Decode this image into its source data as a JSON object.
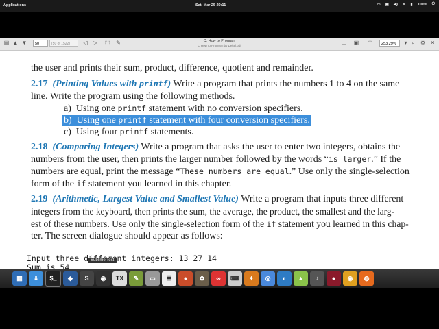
{
  "topbar": {
    "applications": "Applications",
    "clock": "Sat, Mar 25   20:11",
    "battery": "100%"
  },
  "toolbar": {
    "page_value": "50",
    "page_of": "(50 of 1522)",
    "title": "C: How to Program",
    "subtitle": "C How to Program by Deitel.pdf",
    "zoom": "253.29%"
  },
  "document": {
    "line0": "the user and prints their sum, product, difference, quotient and remainder.",
    "ex217": {
      "num": "2.17",
      "head_a": "(Printing Values with ",
      "head_code": "printf",
      "head_b": ")",
      "text1": " Write a program that prints the numbers 1 to 4 on the same",
      "text2": "line. Write the program using the following methods.",
      "items": [
        {
          "label": "a)",
          "a": "Using one ",
          "code": "printf",
          "b": " statement with no conversion specifiers."
        },
        {
          "label": "b)",
          "a": "Using one ",
          "code": "printf",
          "b": " statement with four conversion specifiers."
        },
        {
          "label": "c)",
          "a": "Using four ",
          "code": "printf",
          "b": " statements."
        }
      ]
    },
    "ex218": {
      "num": "2.18",
      "head": "(Comparing Integers)",
      "l1": " Write a program that asks the user to enter two integers, obtains the",
      "l2a": "numbers from the user, then prints the larger number followed by the words “",
      "l2code": "is larger",
      "l2b": ".” If the",
      "l3a": "numbers are equal, print the message “",
      "l3code": "These numbers are equal",
      "l3b": ".” Use only the single-selection",
      "l4a": "form of the ",
      "l4code": "if",
      "l4b": " statement you learned in this chapter."
    },
    "ex219": {
      "num": "2.19",
      "head": "(Arithmetic, Largest Value and Smallest Value)",
      "l1": " Write a program that inputs three different",
      "l2": "integers from the keyboard, then prints the sum, the average, the product, the smallest and the larg-",
      "l3a": "est of these numbers. Use only the single-selection form of the ",
      "l3code": "if",
      "l3b": " statement you learned in this chap-",
      "l4": "ter. The screen dialogue should appear as follows:"
    },
    "code": {
      "line1": "Input three different integers: 13 27 14",
      "line2": "Sum is 54"
    }
  },
  "tooltip": "Sublime Text",
  "dock_icons": [
    "workspaces-icon",
    "downloads-icon",
    "terminal-icon",
    "virtualbox-icon",
    "sublime-icon",
    "screencast-icon",
    "tex-icon",
    "editor-icon",
    "files-icon",
    "document-viewer-icon",
    "recorder-icon",
    "gimp-icon",
    "flickr-icon",
    "keyboard-icon",
    "puzzle-icon",
    "chromium-icon",
    "earth-icon",
    "android-icon",
    "microphone-icon",
    "media-icon",
    "chrome-icon",
    "firefox-icon"
  ]
}
